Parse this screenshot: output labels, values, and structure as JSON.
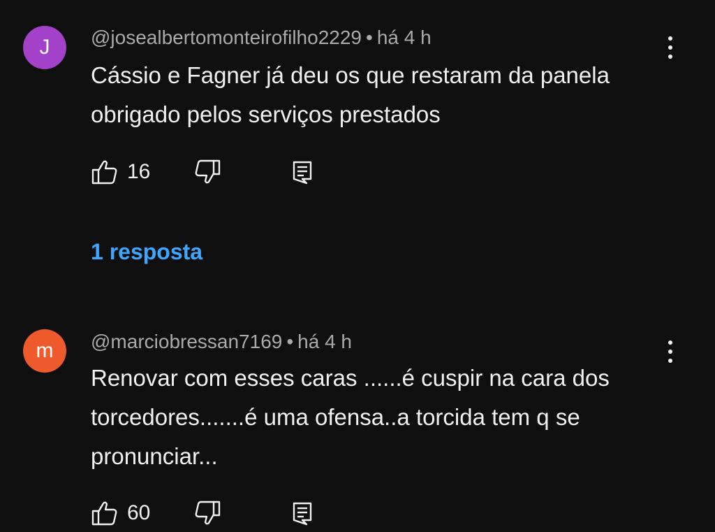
{
  "comments": [
    {
      "avatar_letter": "J",
      "avatar_color": "#a341c9",
      "author": "@josealbertomonteirofilho2229",
      "separator": "•",
      "time": "há 4 h",
      "text_lines": [
        "Cássio e Fagner já deu os que restaram da panela",
        "obrigado pelos serviços prestados"
      ],
      "likes": "16",
      "replies_label": "1 resposta"
    },
    {
      "avatar_letter": "m",
      "avatar_color": "#ef5a2c",
      "author": "@marciobressan7169",
      "separator": "•",
      "time": "há 4 h",
      "text_lines": [
        "Renovar com esses caras ......é cuspir na cara dos",
        "torcedores.......é uma ofensa..a torcida tem q se",
        "pronunciar..."
      ],
      "likes": "60"
    }
  ],
  "icons": {
    "like": "thumbs-up-icon",
    "dislike": "thumbs-down-icon",
    "reply": "reply-comment-icon",
    "menu": "more-vert-icon"
  },
  "colors": {
    "background": "#0f0f0f",
    "link": "#3ea6ff",
    "meta_text": "#aaaaaa",
    "body_text": "#f1f1f1"
  }
}
